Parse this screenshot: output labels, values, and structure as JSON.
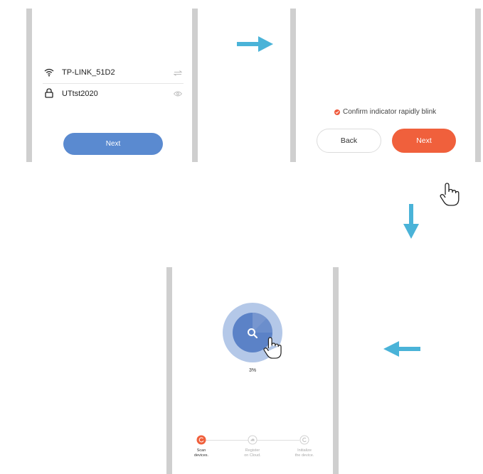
{
  "panel1": {
    "wifi_name": "TP-LINK_51D2",
    "password": "UTtst2020",
    "next_label": "Next"
  },
  "panel2": {
    "confirm_text": "Confirm indicator rapidly blink",
    "back_label": "Back",
    "next_label": "Next"
  },
  "panel3": {
    "progress_text": "3%",
    "progress_value": 3,
    "steps": [
      {
        "line1": "Scan",
        "line2": "devices."
      },
      {
        "line1": "Register",
        "line2": "on Cloud."
      },
      {
        "line1": "Initialize",
        "line2": "the device."
      }
    ]
  },
  "colors": {
    "accent_orange": "#f0603c",
    "button_blue": "#5a8ad0",
    "arrow_blue": "#4ab3d8",
    "scan_circle": "#5b82c7"
  },
  "icons": {
    "wifi": "wifi-icon",
    "lock": "lock-icon",
    "swap": "swap-icon",
    "eye": "eye-icon",
    "search": "search-icon",
    "hand": "hand-pointer-icon"
  }
}
